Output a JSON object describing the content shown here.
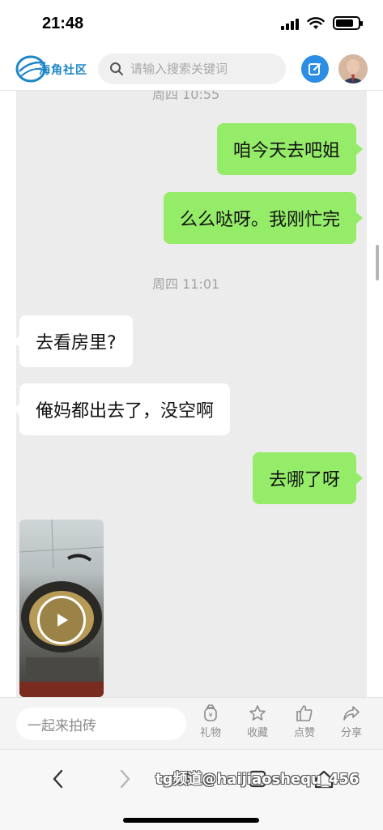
{
  "status_bar": {
    "time": "21:48",
    "battery_level": 0.8
  },
  "header": {
    "logo_text": "海角社区",
    "search_placeholder": "请输入搜索关键词",
    "brand_color": "#1c86c8",
    "edit_icon": "edit-icon"
  },
  "chat": {
    "partial_timestamp": "周四 10:55",
    "messages": [
      {
        "side": "out",
        "text": "咱今天去吧姐"
      },
      {
        "side": "out",
        "text": "么么哒呀。我刚忙完"
      },
      {
        "timestamp": "周四 11:01"
      },
      {
        "side": "in",
        "text": "去看房里?"
      },
      {
        "side": "in",
        "text": "俺妈都出去了，没空啊"
      },
      {
        "side": "out",
        "text": "去哪了呀"
      },
      {
        "side": "in",
        "type": "video",
        "icon": "play-icon"
      }
    ],
    "colors": {
      "out_bubble": "#95ec69",
      "in_bubble": "#ffffff",
      "background": "#ececec"
    }
  },
  "action_bar": {
    "comment_placeholder": "一起来拍砖",
    "actions": [
      {
        "label": "礼物",
        "icon": "gift-icon"
      },
      {
        "label": "收藏",
        "icon": "star-icon"
      },
      {
        "label": "点赞",
        "icon": "thumbs-up-icon"
      },
      {
        "label": "分享",
        "icon": "share-icon"
      }
    ]
  },
  "browser_nav": {
    "watermark": "tg频道@haijiaoshequ_456",
    "buttons": [
      "back-icon",
      "forward-icon",
      "menu-icon",
      "tabs-icon",
      "home-icon"
    ]
  }
}
